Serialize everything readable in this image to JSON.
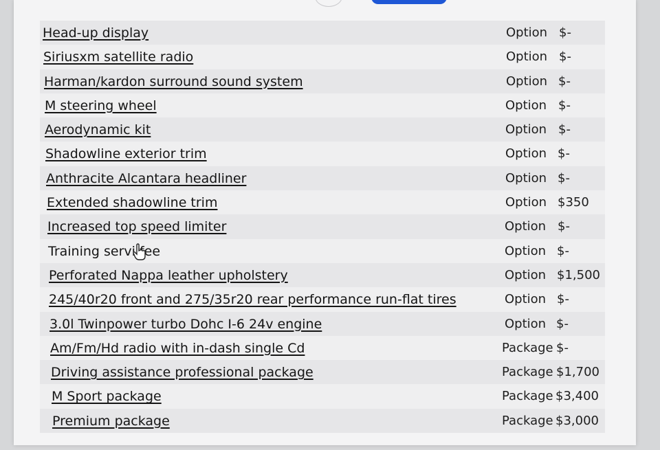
{
  "items": [
    {
      "name": "Head-up display",
      "type": "Option",
      "price": "$-"
    },
    {
      "name": "Siriusxm satellite radio",
      "type": "Option",
      "price": "$-"
    },
    {
      "name": "Harman/kardon surround sound system",
      "type": "Option",
      "price": "$-"
    },
    {
      "name": "M steering wheel",
      "type": "Option",
      "price": "$-"
    },
    {
      "name": "Aerodynamic kit",
      "type": "Option",
      "price": "$-"
    },
    {
      "name": "Shadowline exterior trim",
      "type": "Option",
      "price": "$-"
    },
    {
      "name": "Anthracite Alcantara headliner",
      "type": "Option",
      "price": "$-"
    },
    {
      "name": "Extended shadowline trim",
      "type": "Option",
      "price": "$350"
    },
    {
      "name": "Increased top speed limiter",
      "type": "Option",
      "price": "$-"
    },
    {
      "name": "Training servi   fee",
      "type": "Option",
      "price": "$-"
    },
    {
      "name": "Perforated Nappa leather upholstery",
      "type": "Option",
      "price": "$1,500"
    },
    {
      "name": "245/40r20 front and 275/35r20 rear performance run-flat tires",
      "type": "Option",
      "price": "$-"
    },
    {
      "name": "3.0l Twinpower turbo Dohc I-6 24v engine",
      "type": "Option",
      "price": "$-"
    },
    {
      "name": "Am/Fm/Hd radio with in-dash single Cd",
      "type": "Package",
      "price": "$-"
    },
    {
      "name": "Driving assistance professional package",
      "type": "Package",
      "price": "$1,700"
    },
    {
      "name": "M Sport package",
      "type": "Package",
      "price": "$3,400"
    },
    {
      "name": "Premium package",
      "type": "Package",
      "price": "$3,000"
    }
  ],
  "cursor": "hand-pointer-icon",
  "colors": {
    "accent": "#1e57d6",
    "text": "#151515",
    "row_alt": "#e6e6e8"
  }
}
